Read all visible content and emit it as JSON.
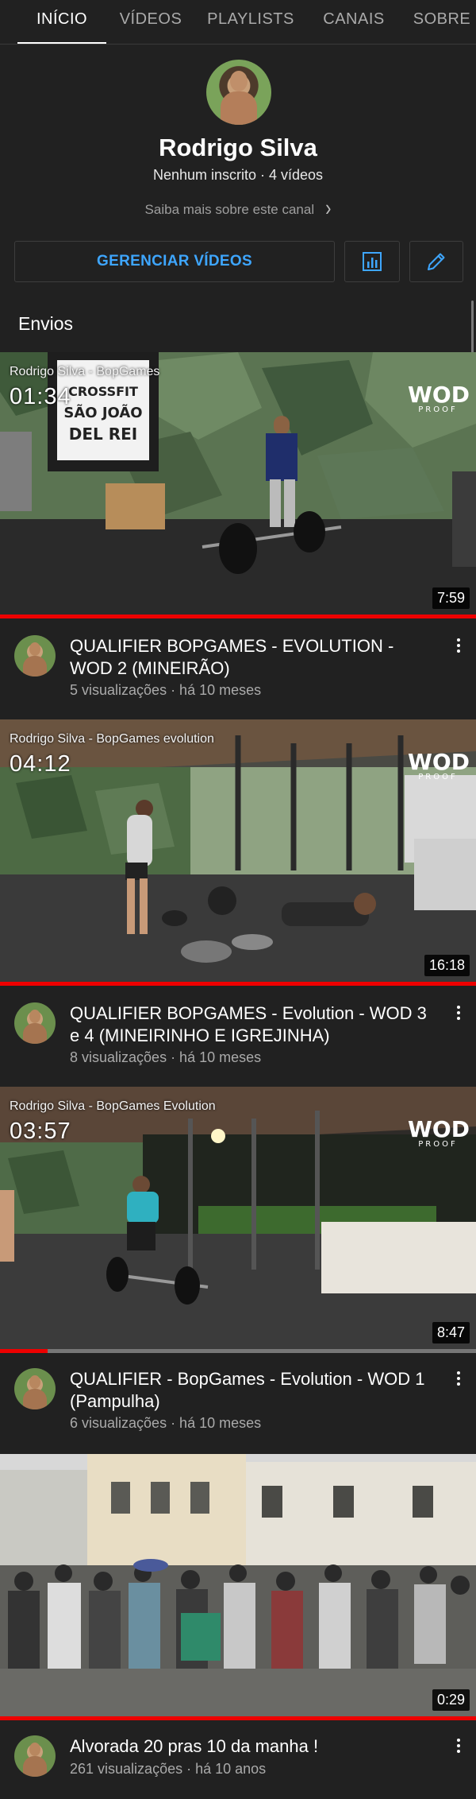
{
  "tabs": [
    {
      "label": "INÍCIO",
      "active": true
    },
    {
      "label": "VÍDEOS",
      "active": false
    },
    {
      "label": "PLAYLISTS",
      "active": false
    },
    {
      "label": "CANAIS",
      "active": false
    },
    {
      "label": "SOBRE",
      "active": false
    }
  ],
  "channel": {
    "name": "Rodrigo Silva",
    "meta": "Nenhum inscrito · 4 vídeos",
    "about_link": "Saiba mais sobre este canal",
    "avatar_icon": "channel-avatar"
  },
  "actions": {
    "manage_label": "GERENCIAR VÍDEOS",
    "analytics_icon": "bar-chart-icon",
    "edit_icon": "pencil-icon"
  },
  "section": {
    "title": "Envios"
  },
  "videos": [
    {
      "title": "QUALIFIER BOPGAMES - EVOLUTION - WOD 2 (MINEIRÃO)",
      "meta": "5 visualizações · há 10 meses",
      "duration": "7:59",
      "watched": 1.0,
      "overlay_title": "Rodrigo Silva - BopGames",
      "overlay_time": "01:34",
      "logo": "WOD",
      "logo_sub": "PROOF",
      "wall_text": "CROSSFIT SÃO JOÃO DEL REI"
    },
    {
      "title": "QUALIFIER BOPGAMES - Evolution - WOD 3 e 4 (MINEIRINHO E IGREJINHA)",
      "meta": "8 visualizações · há 10 meses",
      "duration": "16:18",
      "watched": 1.0,
      "overlay_title": "Rodrigo Silva - BopGames evolution",
      "overlay_time": "04:12",
      "logo": "WOD",
      "logo_sub": "PROOF"
    },
    {
      "title": "QUALIFIER - BopGames - Evolution - WOD 1 (Pampulha)",
      "meta": "6 visualizações · há 10 meses",
      "duration": "8:47",
      "watched": 0.1,
      "overlay_title": "Rodrigo Silva - BopGames Evolution",
      "overlay_time": "03:57",
      "logo": "WOD",
      "logo_sub": "PROOF"
    },
    {
      "title": "Alvorada 20 pras 10 da manha !",
      "meta": "261 visualizações · há 10 anos",
      "duration": "0:29",
      "watched": 1.0
    }
  ],
  "colors": {
    "background": "#212121",
    "accent_blue": "#3ea6ff",
    "progress_red": "#e00000",
    "meta_gray": "#aaaaaa"
  }
}
